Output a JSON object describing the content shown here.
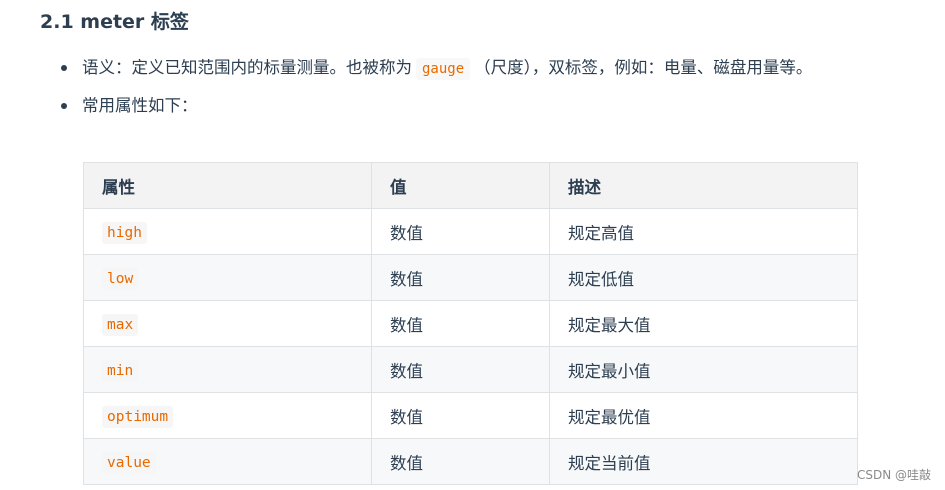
{
  "heading": "2.1 meter 标签",
  "bullets": {
    "semantics": {
      "before": "语义：定义已知范围内的标量测量。也被称为",
      "code": "gauge",
      "after": "（尺度），双标签，例如：电量、磁盘用量等。"
    },
    "attrs_intro": "常用属性如下："
  },
  "table": {
    "headers": [
      "属性",
      "值",
      "描述"
    ],
    "rows": [
      {
        "attr": "high",
        "value": "数值",
        "desc": "规定高值"
      },
      {
        "attr": "low",
        "value": "数值",
        "desc": "规定低值"
      },
      {
        "attr": "max",
        "value": "数值",
        "desc": "规定最大值"
      },
      {
        "attr": "min",
        "value": "数值",
        "desc": "规定最小值"
      },
      {
        "attr": "optimum",
        "value": "数值",
        "desc": "规定最优值"
      },
      {
        "attr": "value",
        "value": "数值",
        "desc": "规定当前值"
      }
    ]
  },
  "watermark": "CSDN @哇敲",
  "colors": {
    "text": "#2c3e50",
    "code": "#e96900",
    "header_bg": "#f3f3f3",
    "border": "#dfe2e5"
  }
}
